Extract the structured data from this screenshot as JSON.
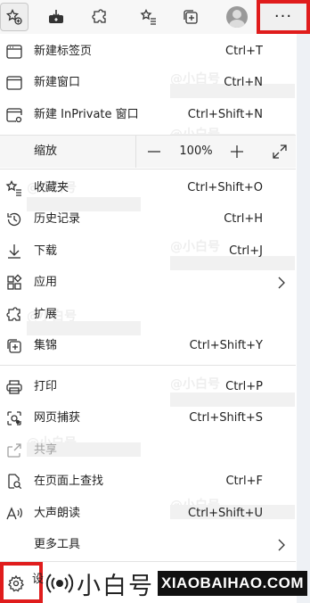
{
  "toolbar": {
    "icons": [
      "favorites-star-icon",
      "download-icon",
      "extensions-icon",
      "favorites-list-icon",
      "collections-icon",
      "profile-avatar"
    ],
    "more_label": "···"
  },
  "menu": {
    "new_tab": {
      "label": "新建标签页",
      "shortcut": "Ctrl+T"
    },
    "new_window": {
      "label": "新建窗口",
      "shortcut": "Ctrl+N"
    },
    "new_inprivate": {
      "label": "新建 InPrivate 窗口",
      "shortcut": "Ctrl+Shift+N"
    },
    "zoom": {
      "label": "缩放",
      "minus": "—",
      "value": "100%",
      "plus": "+"
    },
    "favorites": {
      "label": "收藏夹",
      "shortcut": "Ctrl+Shift+O"
    },
    "history": {
      "label": "历史记录",
      "shortcut": "Ctrl+H"
    },
    "downloads": {
      "label": "下载",
      "shortcut": "Ctrl+J"
    },
    "apps": {
      "label": "应用"
    },
    "extensions": {
      "label": "扩展"
    },
    "collections": {
      "label": "集锦",
      "shortcut": "Ctrl+Shift+Y"
    },
    "print": {
      "label": "打印",
      "shortcut": "Ctrl+P"
    },
    "web_capture": {
      "label": "网页捕获",
      "shortcut": "Ctrl+Shift+S"
    },
    "share": {
      "label": "共享"
    },
    "find": {
      "label": "在页面上查找",
      "shortcut": "Ctrl+F"
    },
    "read_aloud": {
      "label": "大声朗读",
      "shortcut": "Ctrl+Shift+U"
    },
    "more_tools": {
      "label": "更多工具"
    },
    "settings": {
      "label": "设"
    }
  },
  "watermark": {
    "cn": "@小白号",
    "en": "XIAOBAIHAO.COM",
    "brand_cn": "小白号",
    "brand_en": "XIAOBAIHAO.COM"
  },
  "colors": {
    "highlight": "#e01c1c",
    "menu_bg": "#ffffff",
    "zoom_bg": "#f6f6f6"
  }
}
